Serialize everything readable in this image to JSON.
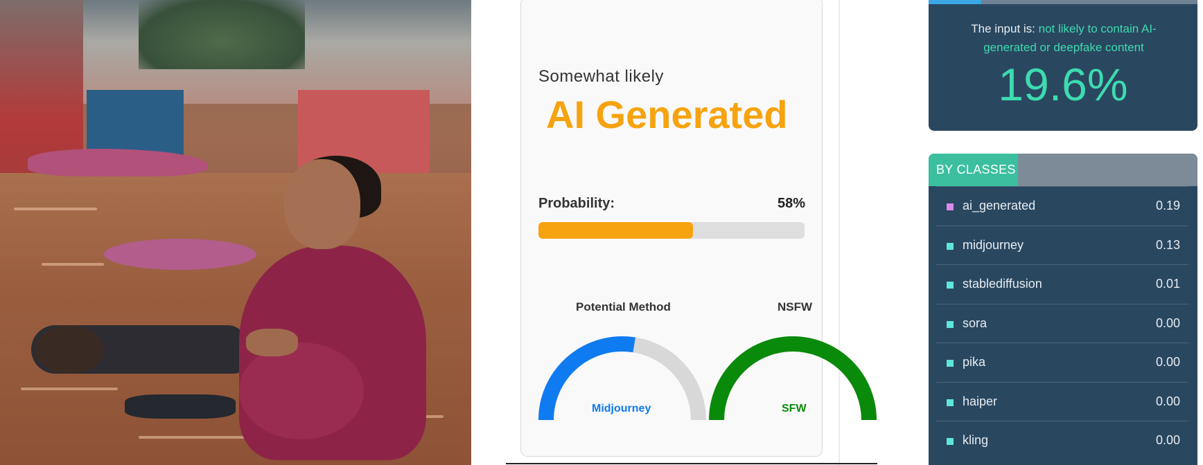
{
  "result": {
    "likelihood_label": "Somewhat likely",
    "verdict": "AI Generated",
    "probability_label": "Probability:",
    "probability_value": "58%",
    "probability_fraction": 0.58,
    "accent_color": "#f7a30f"
  },
  "gauges": {
    "method": {
      "title": "Potential Method",
      "label": "Midjourney",
      "color": "#0f7bf0",
      "fill_fraction": 0.55
    },
    "nsfw": {
      "title": "NSFW",
      "label": "SFW",
      "color": "#0a8a0a",
      "fill_fraction": 1.0
    }
  },
  "summary": {
    "prefix": "The input is:",
    "highlight": "not likely to contain AI-generated or deepfake content",
    "percentage": "19.6%",
    "bar_fraction": 0.196,
    "highlight_color": "#3ddbb0"
  },
  "classes": {
    "header": "BY CLASSES",
    "items": [
      {
        "name": "ai_generated",
        "value": "0.19",
        "color": "#d98be8"
      },
      {
        "name": "midjourney",
        "value": "0.13",
        "color": "#5fe6dc"
      },
      {
        "name": "stablediffusion",
        "value": "0.01",
        "color": "#5fe6dc"
      },
      {
        "name": "sora",
        "value": "0.00",
        "color": "#5fe6dc"
      },
      {
        "name": "pika",
        "value": "0.00",
        "color": "#5fe6dc"
      },
      {
        "name": "haiper",
        "value": "0.00",
        "color": "#5fe6dc"
      },
      {
        "name": "kling",
        "value": "0.00",
        "color": "#5fe6dc"
      }
    ]
  }
}
